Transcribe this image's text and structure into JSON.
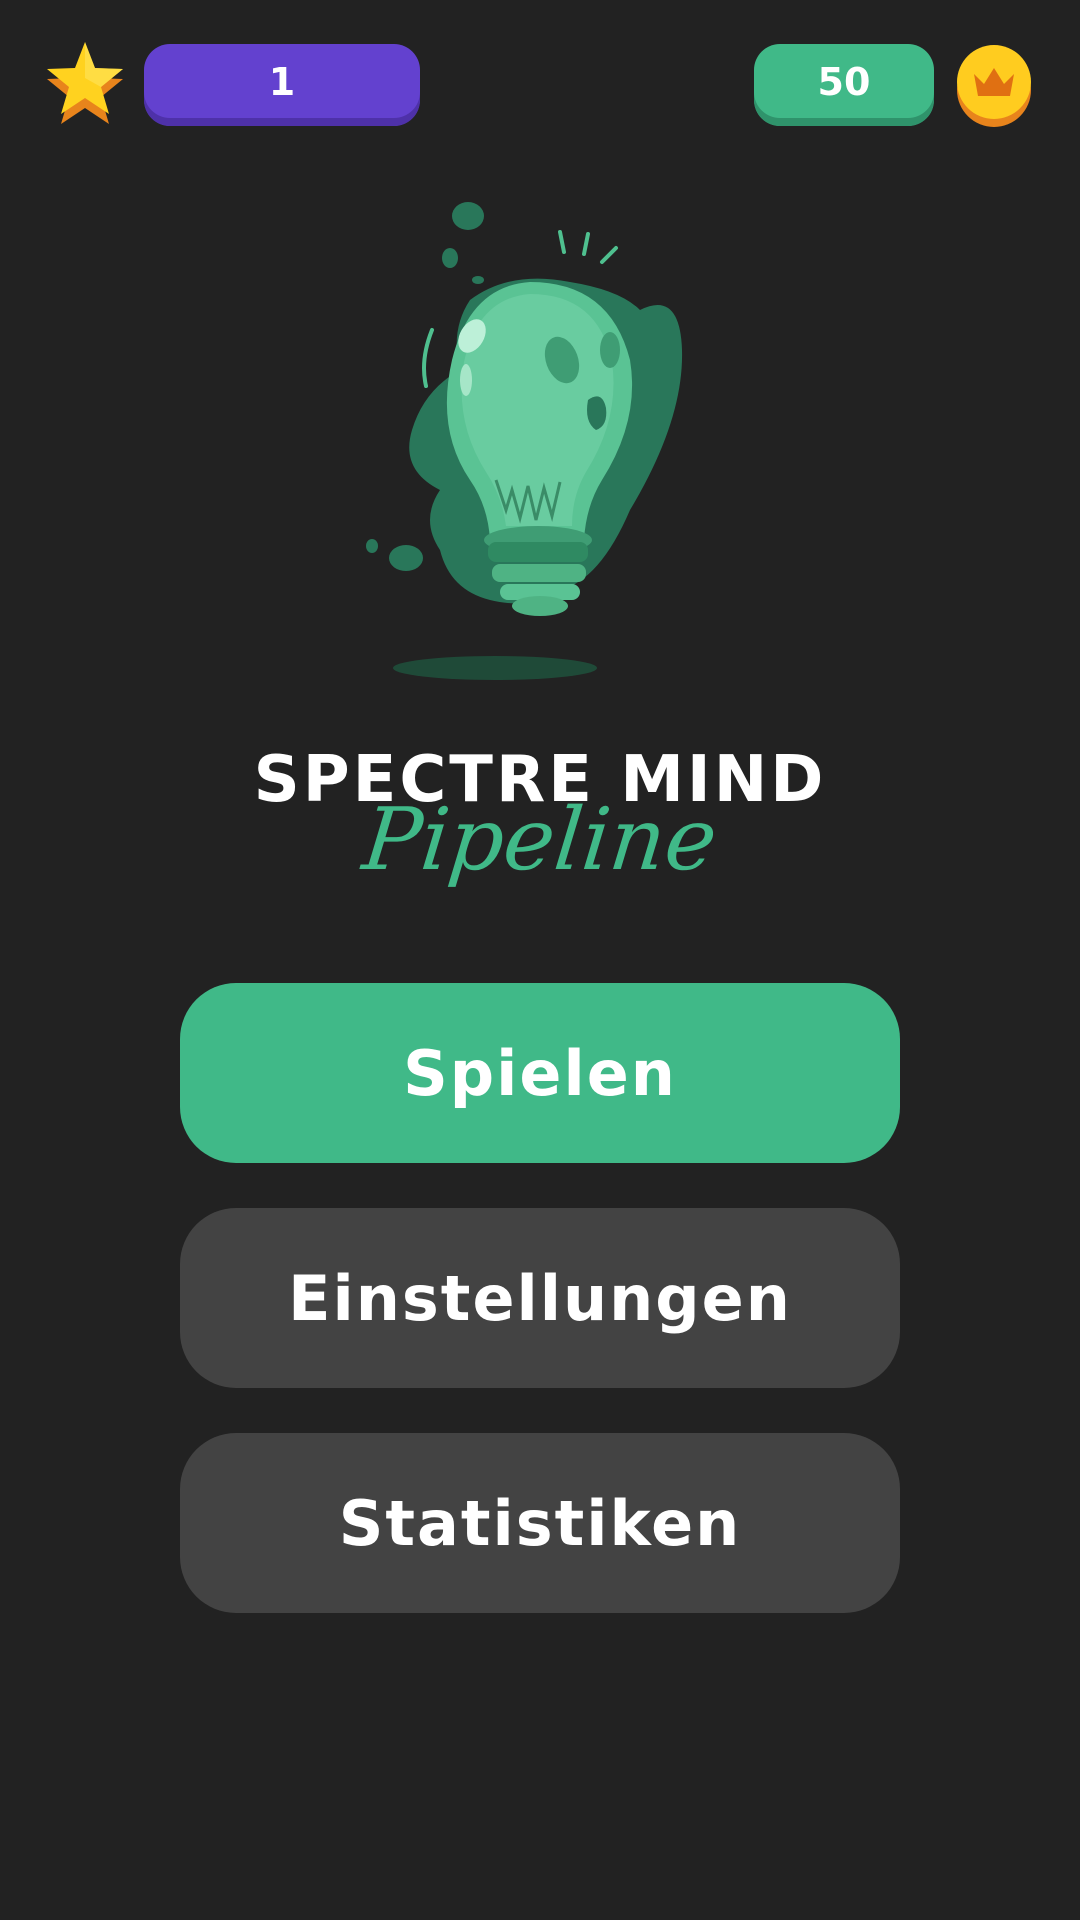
{
  "topbar": {
    "level": "1",
    "coins": "50",
    "level_icon": "star-icon",
    "coins_icon": "crown-coin-icon"
  },
  "hero": {
    "icon": "lightbulb-illustration"
  },
  "title": {
    "main": "SPECTRE MIND",
    "sub": "Pipeline"
  },
  "menu": {
    "play": "Spielen",
    "settings": "Einstellungen",
    "stats": "Statistiken"
  },
  "colors": {
    "background": "#222222",
    "level_pill": "#6341cf",
    "accent_green": "#40b988",
    "secondary_button": "#434343",
    "text": "#ffffff"
  }
}
